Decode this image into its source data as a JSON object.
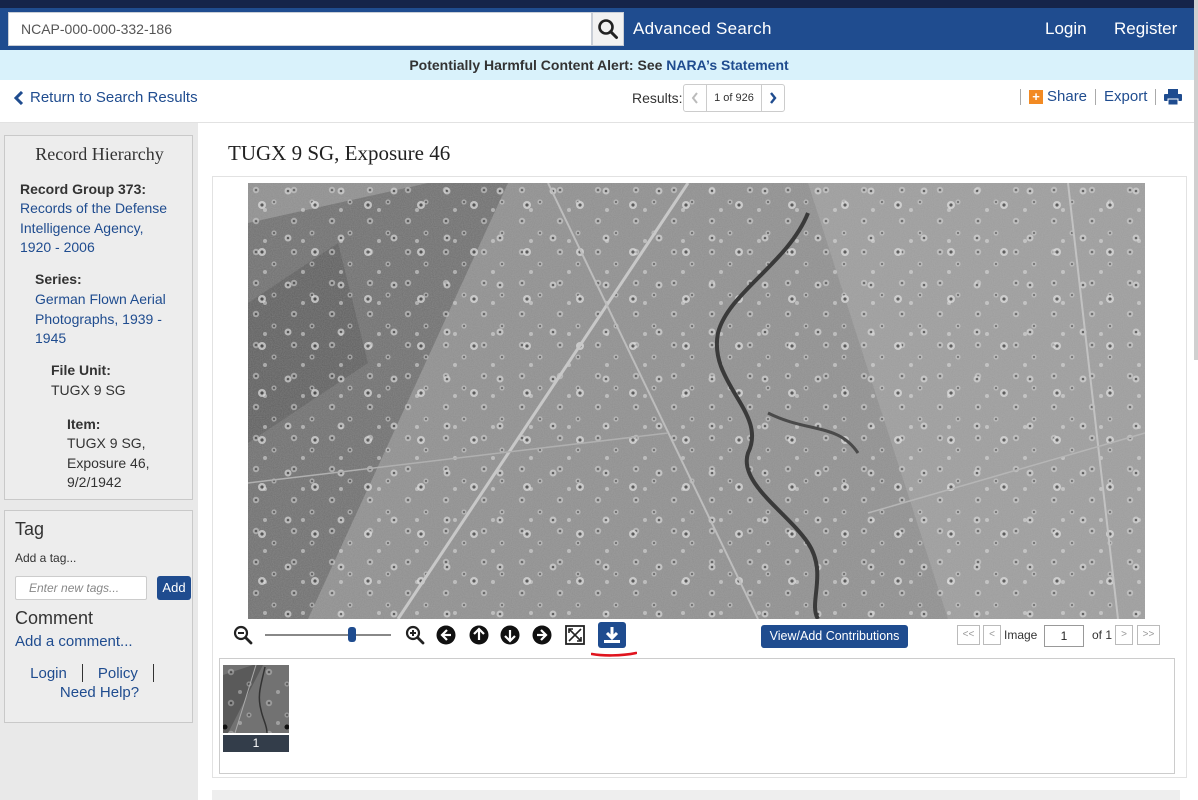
{
  "header": {
    "search_value": "NCAP-000-000-332-186",
    "advanced_search": "Advanced Search",
    "login": "Login",
    "register": "Register"
  },
  "alert": {
    "text": "Potentially Harmful Content Alert: See",
    "link": "NARA’s Statement"
  },
  "subbar": {
    "return_link": "Return to Search Results",
    "results_label": "Results:",
    "results_count": "1 of 926",
    "share": "Share",
    "export": "Export"
  },
  "hierarchy": {
    "title": "Record Hierarchy",
    "record_group_label": "Record Group 373:",
    "record_group_lines": [
      "Records of the Defense",
      "Intelligence Agency,",
      "1920 - 2006"
    ],
    "series_label": "Series:",
    "series_lines": [
      "German Flown Aerial",
      "Photographs, 1939 -",
      "1945"
    ],
    "file_unit_label": "File Unit:",
    "file_unit_value": "TUGX 9 SG",
    "item_label": "Item:",
    "item_lines": [
      "TUGX 9 SG,",
      "Exposure 46,",
      "9/2/1942"
    ]
  },
  "tag": {
    "title": "Tag",
    "add_text": "Add a tag...",
    "input_placeholder": "Enter new tags...",
    "add_button": "Add",
    "comment_title": "Comment",
    "add_comment": "Add a comment...",
    "login": "Login",
    "policy": "Policy",
    "need_help": "Need Help?"
  },
  "record": {
    "title": "TUGX 9 SG, Exposure 46"
  },
  "viewer": {
    "zoom_level": 0.7,
    "contributions_button": "View/Add Contributions",
    "first": "<<",
    "prev": "<",
    "image_label": "Image",
    "image_value": "1",
    "of_label": "of 1",
    "next": ">",
    "last": ">>",
    "thumbnail_number": "1"
  },
  "colors": {
    "brand_blue": "#1f4c8f",
    "alert_bg": "#d9f2fb",
    "accent_orange": "#f28a23"
  }
}
